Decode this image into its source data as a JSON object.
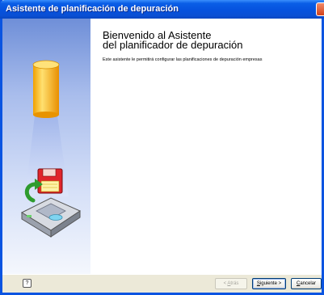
{
  "window": {
    "title": "Asistente de planificación de depuración"
  },
  "welcome": {
    "heading_line1": "Bienvenido al Asistente",
    "heading_line2": "del planificador de depuración",
    "description": "Este asistente le permitirá configurar las planificaciones de depuración empresas"
  },
  "footer": {
    "help_icon": "help-icon",
    "back_prefix": "< ",
    "back_mnemonic": "A",
    "back_rest": "trás",
    "next_mnemonic": "S",
    "next_rest": "iguiente >",
    "cancel_mnemonic": "C",
    "cancel_rest": "ancelar"
  },
  "colors": {
    "titlebar": "#0a54e1",
    "side_panel_top": "#6f8fd8",
    "cylinder": "#f7b81c",
    "disk": "#e0242b"
  }
}
